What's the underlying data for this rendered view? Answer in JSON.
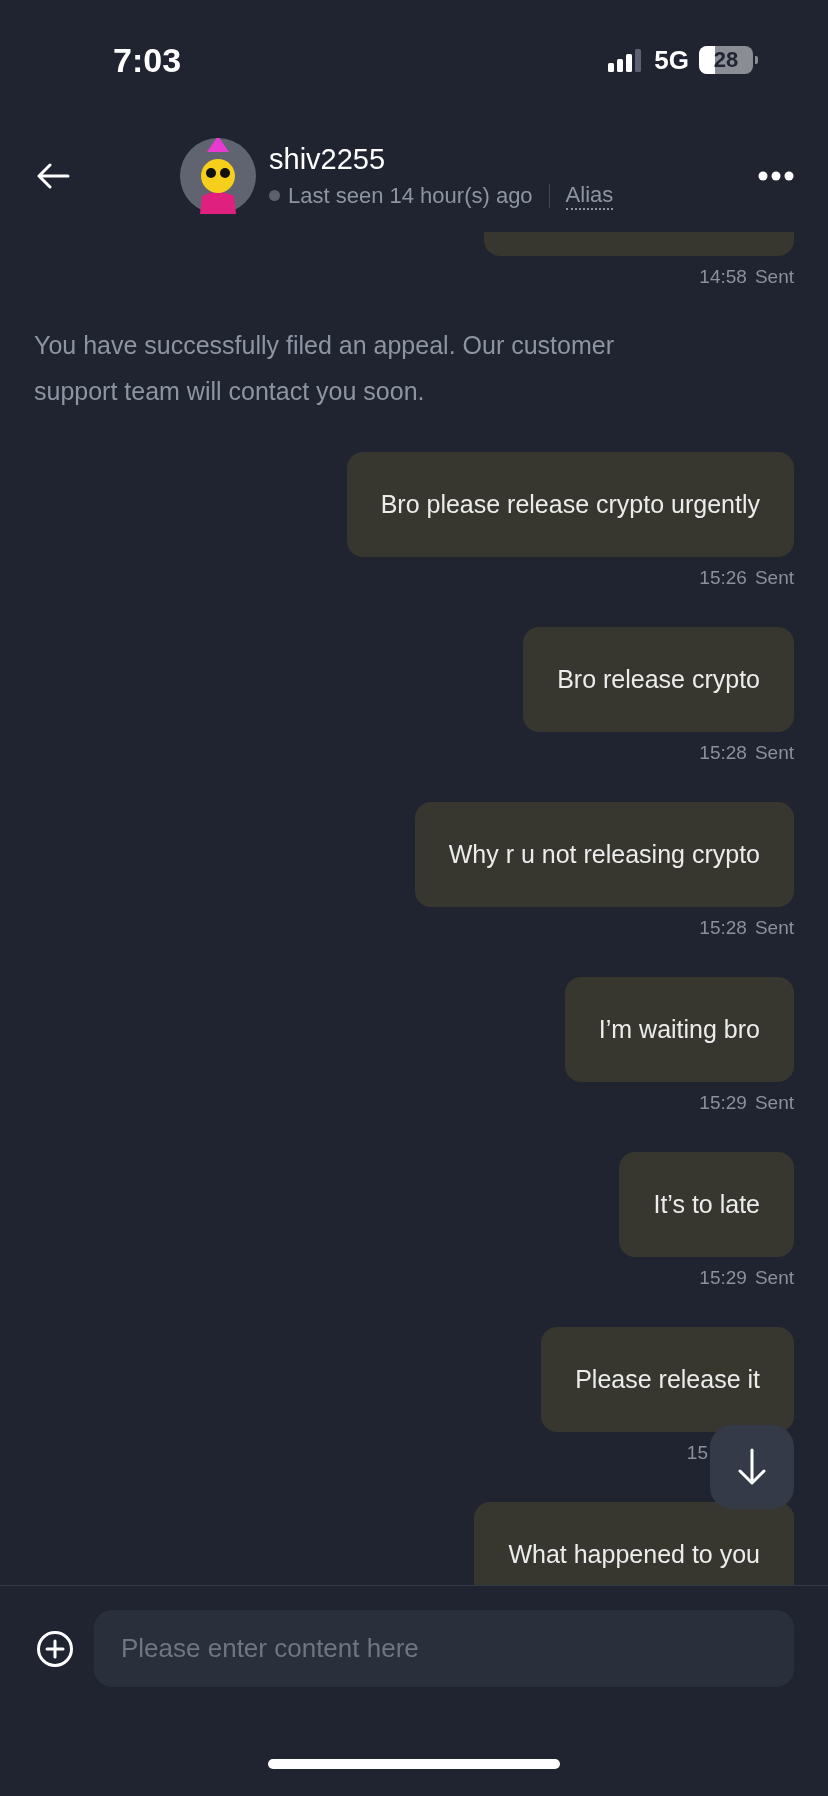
{
  "status_bar": {
    "time": "7:03",
    "network": "5G",
    "battery": "28"
  },
  "header": {
    "name": "shiv2255",
    "online": false,
    "last_seen": "Last seen 14 hour(s) ago",
    "alias": "Alias"
  },
  "messages": [
    {
      "kind": "outgoing_clipped",
      "time": "14:58",
      "status": "Sent"
    },
    {
      "kind": "system",
      "text": "You have successfully filed an appeal. Our customer support team will contact you soon."
    },
    {
      "kind": "outgoing",
      "text": "Bro please release crypto urgently",
      "time": "15:26",
      "status": "Sent"
    },
    {
      "kind": "outgoing",
      "text": "Bro release crypto",
      "time": "15:28",
      "status": "Sent"
    },
    {
      "kind": "outgoing",
      "text": "Why r u not releasing crypto",
      "time": "15:28",
      "status": "Sent"
    },
    {
      "kind": "outgoing",
      "text": "I’m waiting bro",
      "time": "15:29",
      "status": "Sent"
    },
    {
      "kind": "outgoing",
      "text": "It’s to late",
      "time": "15:29",
      "status": "Sent"
    },
    {
      "kind": "outgoing",
      "text": "Please release it",
      "time": "15"
    },
    {
      "kind": "outgoing",
      "text": "What happened to you"
    }
  ],
  "composer": {
    "placeholder": "Please enter content here"
  }
}
